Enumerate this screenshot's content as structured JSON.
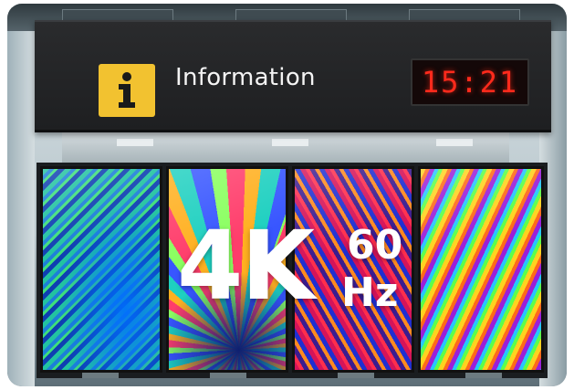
{
  "sign": {
    "icon": "info-icon",
    "label": "Information",
    "clock": "15:21"
  },
  "overlay": {
    "resolution": "4K",
    "refresh_value": "60",
    "refresh_unit": "Hz"
  },
  "colors": {
    "sign_background": "#1e1f21",
    "info_icon_yellow": "#f2c230",
    "clock_red": "#ff2a1c",
    "overlay_text": "#ffffff"
  }
}
